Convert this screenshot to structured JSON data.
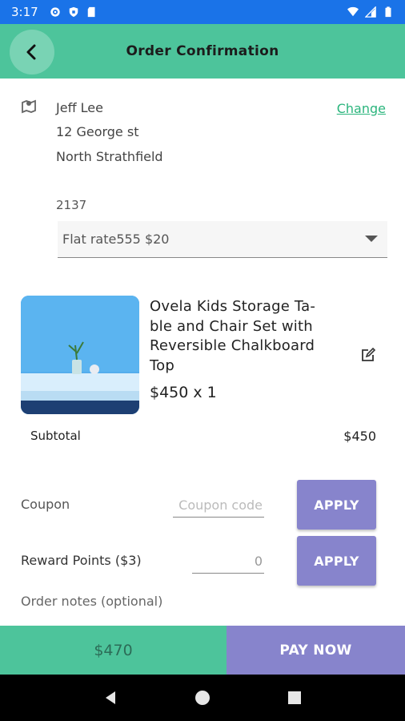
{
  "status_bar": {
    "time": "3:17"
  },
  "app_bar": {
    "title": "Order Confirmation"
  },
  "address": {
    "name": "Jeff Lee",
    "street": "12 George st",
    "suburb": "North Strathfield",
    "postcode": "2137",
    "change_label": "Change"
  },
  "shipping": {
    "selected": "Flat rate555 $20"
  },
  "product": {
    "name": "Ovela Kids Storage Ta-ble and Chair Set with Reversible Chalkboard Top",
    "name_lines": [
      "Ovela Kids Storage Ta-",
      "ble and Chair Set with",
      "Reversible Chalkboard",
      "Top"
    ],
    "price_qty": "$450 x 1"
  },
  "subtotal": {
    "label": "Subtotal",
    "value": "$450"
  },
  "coupon": {
    "label": "Coupon",
    "placeholder": "Coupon code",
    "apply_label": "APPLY"
  },
  "reward": {
    "label": "Reward Points ($3)",
    "value": "0",
    "apply_label": "APPLY"
  },
  "notes": {
    "label": "Order notes (optional)"
  },
  "footer": {
    "total": "$470",
    "pay_label": "PAY NOW"
  },
  "colors": {
    "accent_green": "#4dc49b",
    "accent_purple": "#8784cc",
    "status_blue": "#1a73e8",
    "link_green": "#2bb57d"
  }
}
